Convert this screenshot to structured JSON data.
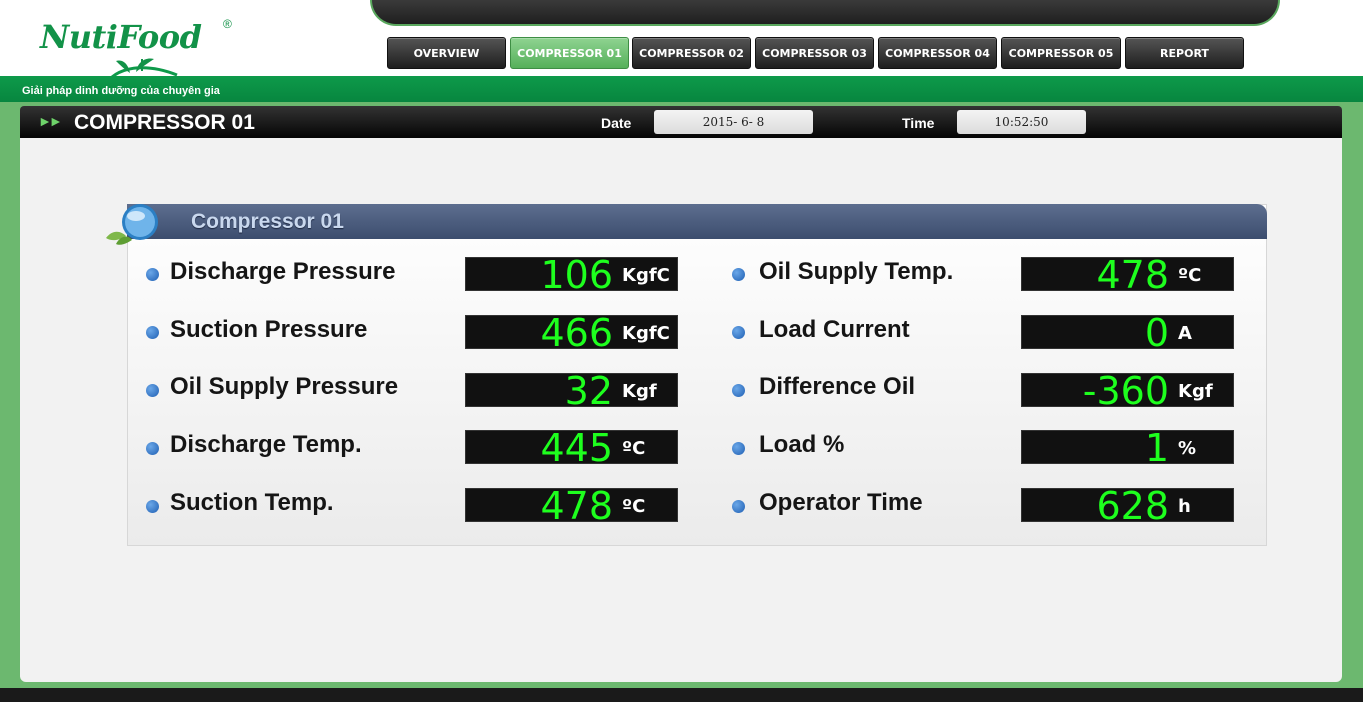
{
  "brand": {
    "logo_text": "NutiFood",
    "registered_mark": "®",
    "tagline": "Giải pháp dinh dưỡng của chuyên gia",
    "brand_color": "#129248"
  },
  "nav": {
    "items": [
      {
        "label": "OVERVIEW",
        "active": false
      },
      {
        "label": "COMPRESSOR 01",
        "active": true
      },
      {
        "label": "COMPRESSOR 02",
        "active": false
      },
      {
        "label": "COMPRESSOR 03",
        "active": false
      },
      {
        "label": "COMPRESSOR 04",
        "active": false
      },
      {
        "label": "COMPRESSOR 05",
        "active": false
      },
      {
        "label": "REPORT",
        "active": false
      }
    ]
  },
  "titlebar": {
    "arrow_glyph": "►►",
    "title": "COMPRESSOR 01",
    "date_label": "Date",
    "date_value": "2015- 6- 8",
    "time_label": "Time",
    "time_value": "10:52:50"
  },
  "panel": {
    "title": "Compressor 01",
    "metrics_left": [
      {
        "label": "Discharge Pressure",
        "value": "106",
        "unit": "KgfC"
      },
      {
        "label": "Suction Pressure",
        "value": "466",
        "unit": "KgfC"
      },
      {
        "label": "Oil Supply Pressure",
        "value": "32",
        "unit": "Kgf"
      },
      {
        "label": "Discharge Temp.",
        "value": "445",
        "unit": "ºC"
      },
      {
        "label": "Suction Temp.",
        "value": "478",
        "unit": "ºC"
      }
    ],
    "metrics_right": [
      {
        "label": "Oil Supply Temp.",
        "value": "478",
        "unit": "ºC"
      },
      {
        "label": "Load Current",
        "value": "0",
        "unit": "A"
      },
      {
        "label": "Difference Oil",
        "value": "-360",
        "unit": "Kgf"
      },
      {
        "label": "Load %",
        "value": "1",
        "unit": "%"
      },
      {
        "label": "Operator Time",
        "value": "628",
        "unit": "h"
      }
    ],
    "value_color": "#1eff1e"
  }
}
